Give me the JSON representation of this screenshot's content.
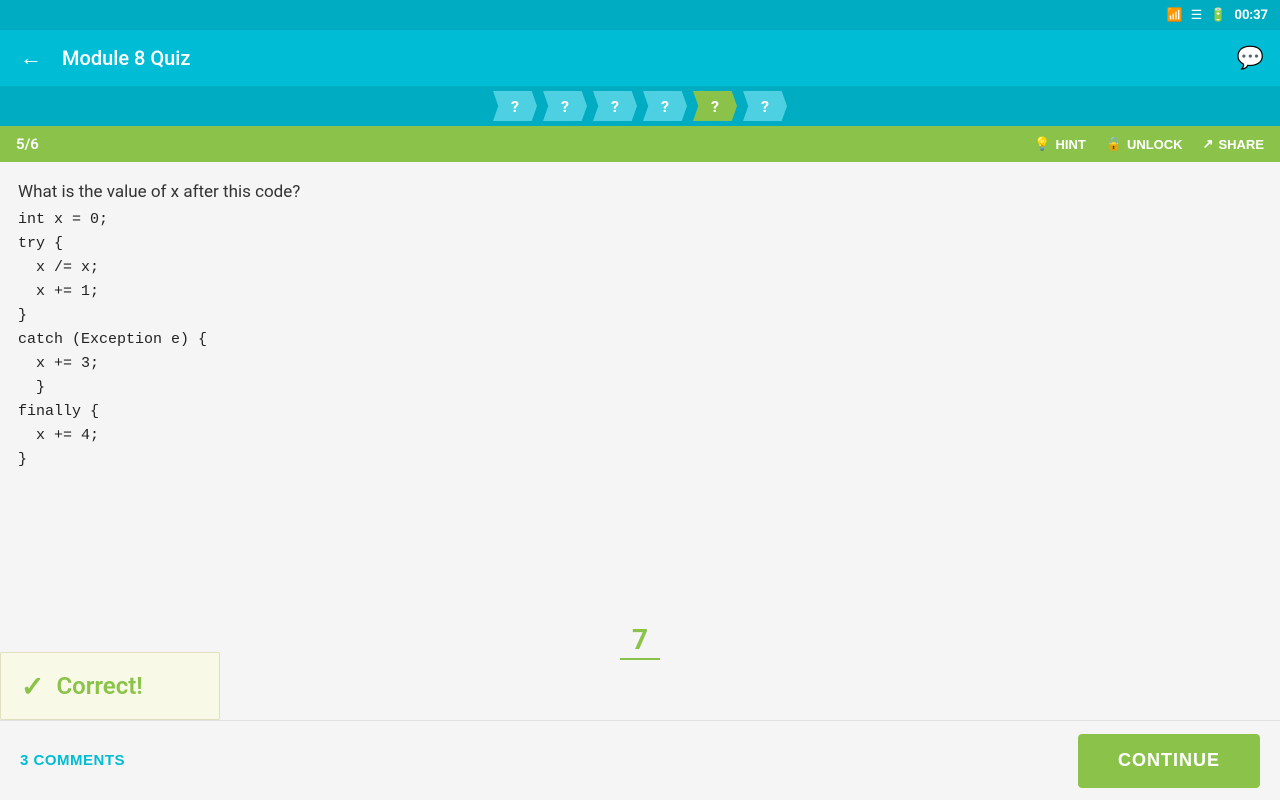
{
  "statusBar": {
    "wifiIcon": "wifi",
    "signalIcon": "signal",
    "batteryIcon": "battery",
    "time": "00:37"
  },
  "appBar": {
    "backIcon": "arrow-left",
    "title": "Module 8 Quiz",
    "chatIcon": "chat"
  },
  "progress": {
    "steps": [
      "?",
      "?",
      "?",
      "?",
      "?",
      "?"
    ],
    "activeStep": 4
  },
  "questionBar": {
    "count": "5/6",
    "hint": "HINT",
    "unlock": "UNLOCK",
    "share": "SHARE"
  },
  "question": {
    "text": "What is the value of x after this code?",
    "code": "int x = 0;\ntry {\n  x /= x;\n  x += 1;\n}\ncatch (Exception e) {\n  x += 3;\n  }\nfinally {\n  x += 4;\n}"
  },
  "answer": {
    "value": "7"
  },
  "correctBanner": {
    "checkmark": "✓",
    "text": "Correct!"
  },
  "bottomBar": {
    "commentsCount": "3",
    "commentsLabel": "COMMENTS",
    "continueLabel": "CONTINUE"
  }
}
